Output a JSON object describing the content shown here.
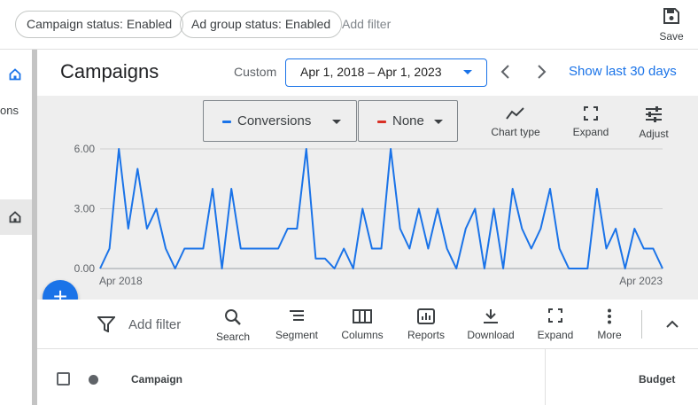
{
  "filter_bar": {
    "chips": [
      "Campaign status: Enabled",
      "Ad group status: Enabled"
    ],
    "add_filter": "Add filter",
    "save_label": "Save"
  },
  "left_nav": {
    "partial_label": "ons"
  },
  "header": {
    "title": "Campaigns",
    "range_label": "Custom",
    "date_range": "Apr 1, 2018 – Apr 1, 2023",
    "show_last": "Show last 30 days"
  },
  "chart_controls": {
    "metric1": "Conversions",
    "metric1_color": "#1a73e8",
    "metric2": "None",
    "metric2_color": "#d93025",
    "tools": [
      "Chart type",
      "Expand",
      "Adjust"
    ]
  },
  "chart_data": {
    "type": "line",
    "series": [
      {
        "name": "Conversions",
        "color": "#1a73e8",
        "values": [
          0,
          1,
          6,
          2,
          5,
          2,
          3,
          1,
          0,
          1,
          1,
          1,
          4,
          0,
          4,
          1,
          1,
          1,
          1,
          1,
          2,
          2,
          6,
          0.5,
          0.5,
          0,
          1,
          0,
          3,
          1,
          1,
          6,
          2,
          1,
          3,
          1,
          3,
          1,
          0,
          2,
          3,
          0,
          3,
          0,
          4,
          2,
          1,
          2,
          4,
          1,
          0,
          0,
          0,
          4,
          1,
          2,
          0,
          2,
          1,
          1,
          0
        ]
      }
    ],
    "ylim": [
      0,
      6
    ],
    "y_ticks": [
      "0.00",
      "3.00",
      "6.00"
    ],
    "x_tick_labels": [
      "Apr 2018",
      "Apr 2023"
    ],
    "grid": true
  },
  "toolbar": {
    "add_filter": "Add filter",
    "tools": [
      "Search",
      "Segment",
      "Columns",
      "Reports",
      "Download",
      "Expand",
      "More"
    ]
  },
  "table": {
    "columns": [
      "Campaign",
      "Budget"
    ]
  }
}
